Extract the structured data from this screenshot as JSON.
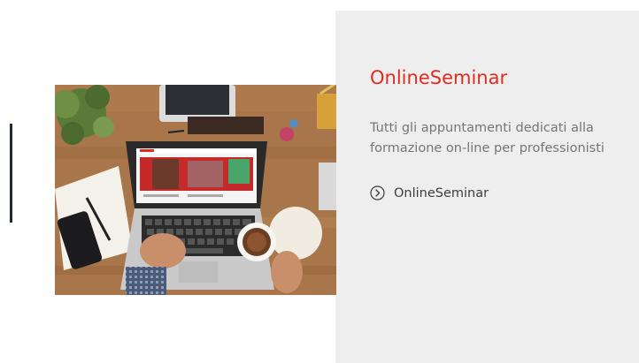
{
  "card": {
    "title": "OnlineSeminar",
    "description": "Tutti gli appuntamenti dedicati alla formazione on-line per professionisti",
    "link": {
      "label": "OnlineSeminar",
      "icon": "chevron-circle-right-icon"
    },
    "image": {
      "subject": "laptop-on-wooden-desk-photo"
    }
  },
  "colors": {
    "accent": "#e22b1f",
    "panel_background": "#eeeeef",
    "text_muted": "#757575",
    "text_dark": "#3c3c3c",
    "left_bar": "#1f2a3a"
  }
}
